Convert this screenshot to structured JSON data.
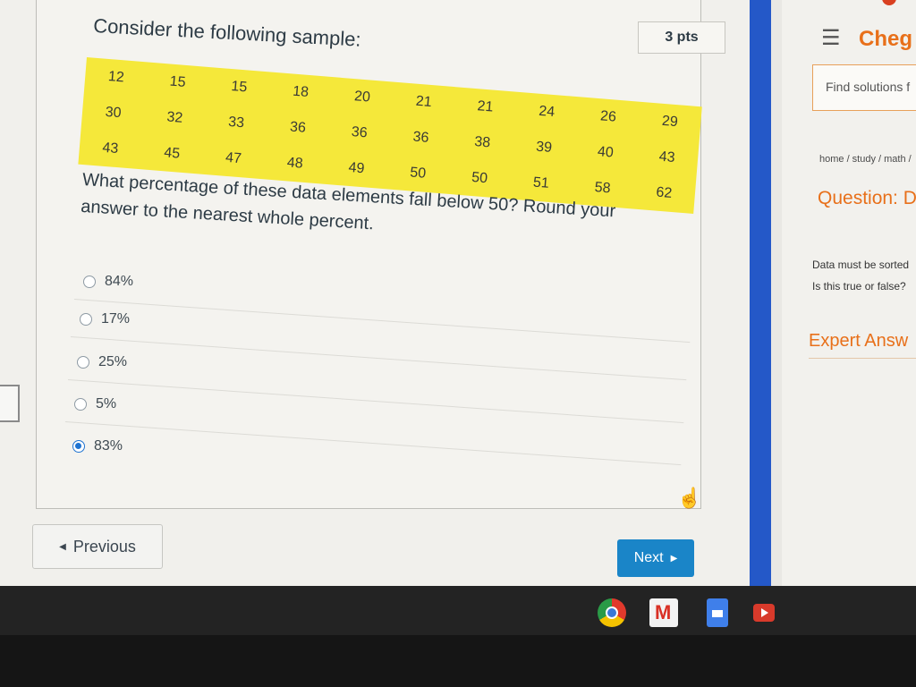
{
  "quiz": {
    "points": "3 pts",
    "prompt": "Consider the following sample:",
    "sample_rows": [
      [
        "12",
        "15",
        "15",
        "18",
        "20",
        "21",
        "21",
        "24",
        "26",
        "29"
      ],
      [
        "30",
        "32",
        "33",
        "36",
        "36",
        "36",
        "38",
        "39",
        "40",
        "43"
      ],
      [
        "43",
        "45",
        "47",
        "48",
        "49",
        "50",
        "50",
        "51",
        "58",
        "62"
      ]
    ],
    "question": "What percentage of these data elements fall below 50? Round your answer to the nearest whole percent.",
    "answers": [
      {
        "label": "84%",
        "selected": false
      },
      {
        "label": "17%",
        "selected": false
      },
      {
        "label": "25%",
        "selected": false
      },
      {
        "label": "5%",
        "selected": false
      },
      {
        "label": "83%",
        "selected": true
      }
    ],
    "previous_label": "Previous",
    "next_label": "Next"
  },
  "chegg": {
    "logo": "Cheg",
    "search_placeholder": "Find solutions f",
    "breadcrumb": "home / study / math /",
    "question_heading": "Question: D",
    "question_line1": "Data must be sorted",
    "question_line2": "Is this true or false?",
    "expert_heading": "Expert Answ"
  },
  "colors": {
    "highlight": "#f5e83a",
    "accent_blue": "#1a85c8",
    "chegg_orange": "#e8701a",
    "selected_radio": "#1f73d1"
  },
  "taskbar": {
    "icons": [
      "chrome-icon",
      "gmail-icon",
      "docs-icon",
      "youtube-icon"
    ]
  }
}
